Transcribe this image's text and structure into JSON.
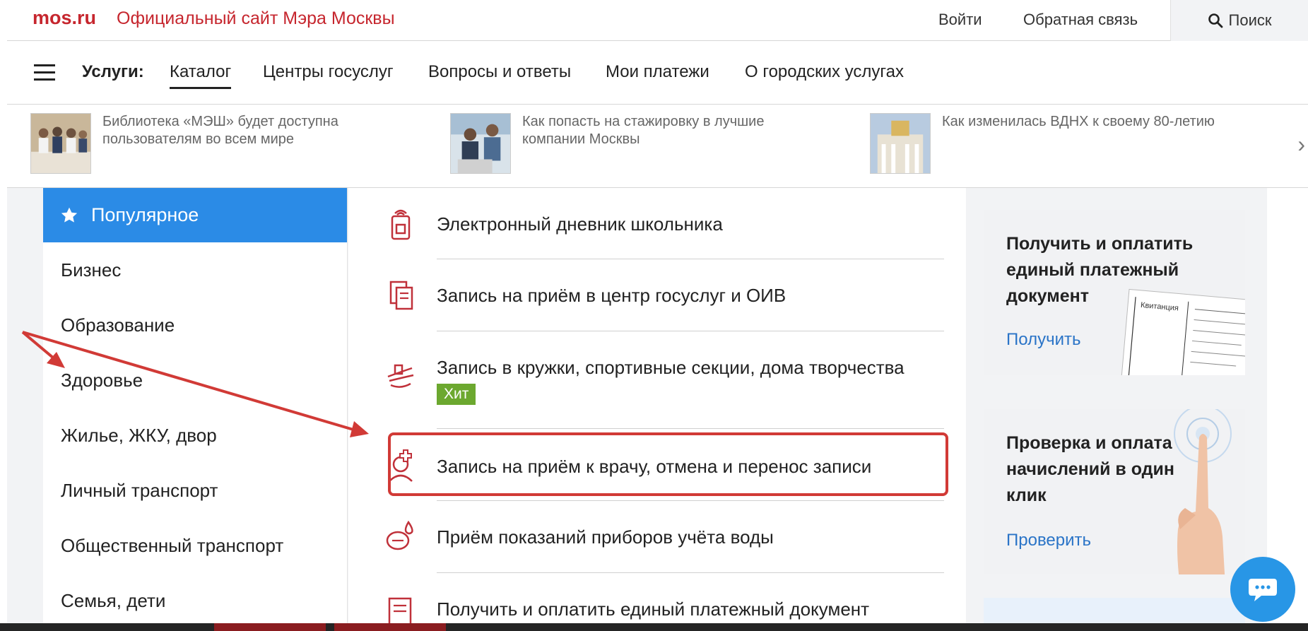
{
  "header": {
    "logo": "mos.ru",
    "site_title": "Официальный сайт Мэра Москвы",
    "login": "Войти",
    "feedback": "Обратная связь",
    "search": "Поиск"
  },
  "nav": {
    "label": "Услуги:",
    "items": [
      "Каталог",
      "Центры госуслуг",
      "Вопросы и ответы",
      "Мои платежи",
      "О городских услугах"
    ],
    "active": "Каталог"
  },
  "news": [
    {
      "text": "Библиотека «МЭШ» будет доступна пользователям во всем мире"
    },
    {
      "text": "Как попасть на стажировку в лучшие компании Москвы"
    },
    {
      "text": "Как изменилась ВДНХ к своему 80-летию"
    }
  ],
  "sidebar": {
    "active": "Популярное",
    "items": [
      "Бизнес",
      "Образование",
      "Здоровье",
      "Жилье, ЖКУ, двор",
      "Личный транспорт",
      "Общественный транспорт",
      "Семья, дети"
    ]
  },
  "services": [
    {
      "label": "Электронный дневник школьника",
      "icon": "school-diary-icon"
    },
    {
      "label": "Запись на приём в центр госуслуг и ОИВ",
      "icon": "document-icon"
    },
    {
      "label": "Запись в кружки, спортивные секции, дома творчества",
      "icon": "clubs-icon",
      "badge": "Хит"
    },
    {
      "label": "Запись на приём к врачу, отмена и перенос записи",
      "icon": "doctor-icon"
    },
    {
      "label": "Приём показаний приборов учёта воды",
      "icon": "water-meter-icon"
    },
    {
      "label": "Получить и оплатить единый платежный документ",
      "icon": "payment-document-icon"
    }
  ],
  "promos": [
    {
      "title": "Получить и оплатить единый платежный документ",
      "link": "Получить",
      "receipt_heading": "Квитанция"
    },
    {
      "title": "Проверка и оплата начислений в один клик",
      "link": "Проверить"
    }
  ],
  "colors": {
    "brand_red": "#c6262e",
    "active_blue": "#2b8be6",
    "link_blue": "#2a74c7",
    "badge_green": "#6ca82f",
    "annotation_red": "#d13a36"
  }
}
